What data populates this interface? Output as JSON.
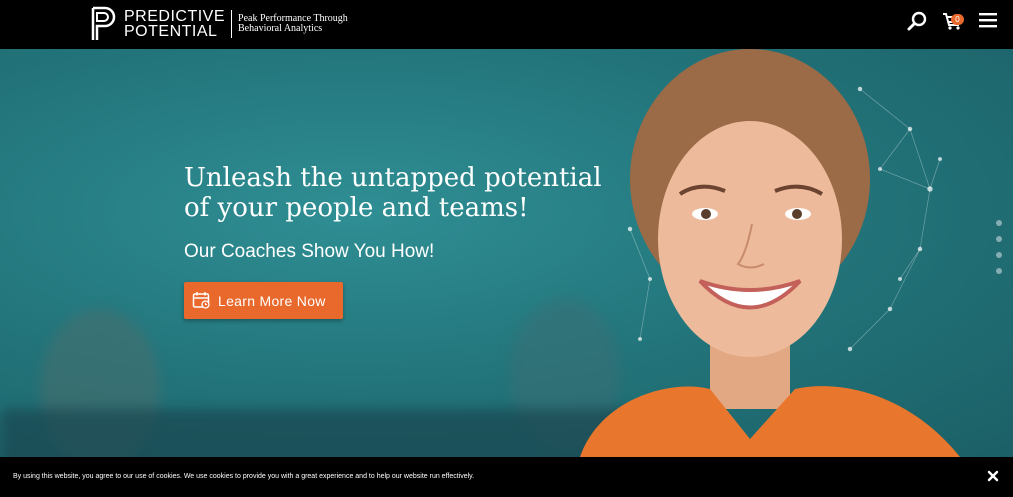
{
  "header": {
    "logo_line1": "PREDICTIVE",
    "logo_line2": "POTENTIAL",
    "tagline_line1": "Peak Performance Through",
    "tagline_line2": "Behavioral Analytics",
    "cart_count": "0",
    "icons": [
      "search-icon",
      "cart-icon",
      "menu-icon"
    ]
  },
  "hero": {
    "title": "Unleash the untapped potential of your people and teams!",
    "subtitle": "Our Coaches Show You How!",
    "cta_label": "Learn More Now",
    "cta_icon": "calendar-icon",
    "slide_count": 4
  },
  "cookie": {
    "text": "By using this website, you agree to our use of cookies. We use cookies to provide you with a great experience and to help our website run effectively."
  },
  "colors": {
    "accent": "#e8692b",
    "hero_teal": "#23777d",
    "header_bg": "#000000"
  }
}
